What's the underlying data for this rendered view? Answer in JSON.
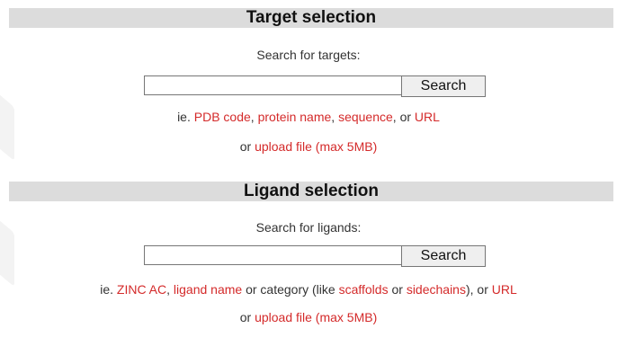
{
  "target": {
    "title": "Target selection",
    "prompt": "Search for targets:",
    "search_value": "",
    "search_button": "Search",
    "hint": {
      "prefix": "ie.",
      "pdb_code": "PDB code",
      "sep1": ",",
      "protein_name": "protein name",
      "sep2": ",",
      "sequence": "sequence",
      "sep3": ", or",
      "url": "URL"
    },
    "upload": {
      "prefix": "or",
      "link": "upload file",
      "suffix": "(max 5MB)"
    }
  },
  "ligand": {
    "title": "Ligand selection",
    "prompt": "Search for ligands:",
    "search_value": "",
    "search_button": "Search",
    "hint": {
      "prefix": "ie.",
      "zinc_ac": "ZINC AC",
      "sep1": ",",
      "ligand_name": "ligand name",
      "mid": "or category (like",
      "scaffolds": "scaffolds",
      "or": "or",
      "sidechains": "sidechains",
      "sep2": "), or",
      "url": "URL"
    },
    "upload": {
      "prefix": "or",
      "link": "upload file",
      "suffix": "(max 5MB)"
    }
  },
  "colors": {
    "link": "#d42a2a",
    "section_bar": "#dcdcdc",
    "text": "#333333"
  }
}
